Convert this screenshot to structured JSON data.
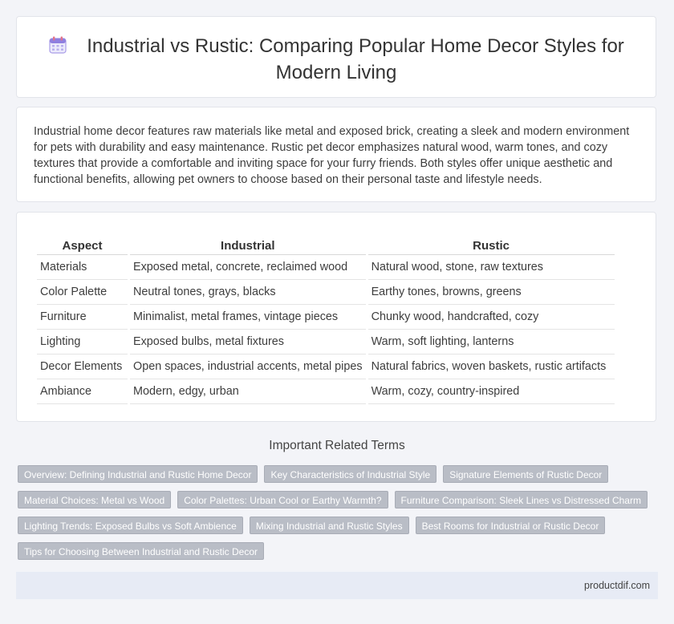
{
  "header": {
    "title": "Industrial vs Rustic: Comparing Popular Home Decor Styles for Modern Living",
    "title_line1": "Industrial vs Rustic: Comparing Popular Home Decor Styles for",
    "title_line2": "Modern Living",
    "icon": "calendar-icon"
  },
  "intro": {
    "text": "Industrial home decor features raw materials like metal and exposed brick, creating a sleek and modern environment for pets with durability and easy maintenance. Rustic pet decor emphasizes natural wood, warm tones, and cozy textures that provide a comfortable and inviting space for your furry friends. Both styles offer unique aesthetic and functional benefits, allowing pet owners to choose based on their personal taste and lifestyle needs."
  },
  "table": {
    "headers": [
      "Aspect",
      "Industrial",
      "Rustic"
    ],
    "rows": [
      [
        "Materials",
        "Exposed metal, concrete, reclaimed wood",
        "Natural wood, stone, raw textures"
      ],
      [
        "Color Palette",
        "Neutral tones, grays, blacks",
        "Earthy tones, browns, greens"
      ],
      [
        "Furniture",
        "Minimalist, metal frames, vintage pieces",
        "Chunky wood, handcrafted, cozy"
      ],
      [
        "Lighting",
        "Exposed bulbs, metal fixtures",
        "Warm, soft lighting, lanterns"
      ],
      [
        "Decor Elements",
        "Open spaces, industrial accents, metal pipes",
        "Natural fabrics, woven baskets, rustic artifacts"
      ],
      [
        "Ambiance",
        "Modern, edgy, urban",
        "Warm, cozy, country-inspired"
      ]
    ]
  },
  "related": {
    "heading": "Important Related Terms",
    "tags": [
      "Overview: Defining Industrial and Rustic Home Decor",
      "Key Characteristics of Industrial Style",
      "Signature Elements of Rustic Decor",
      "Material Choices: Metal vs Wood",
      "Color Palettes: Urban Cool or Earthy Warmth?",
      "Furniture Comparison: Sleek Lines vs Distressed Charm",
      "Lighting Trends: Exposed Bulbs vs Soft Ambience",
      "Mixing Industrial and Rustic Styles",
      "Best Rooms for Industrial or Rustic Decor",
      "Tips for Choosing Between Industrial and Rustic Decor"
    ]
  },
  "footer": {
    "site": "productdif.com"
  },
  "colors": {
    "background": "#f3f4f8",
    "tag_bg": "#b9bdc6",
    "footer_bg": "#e7ebf5",
    "icon_accent": "#8f7fe0"
  }
}
